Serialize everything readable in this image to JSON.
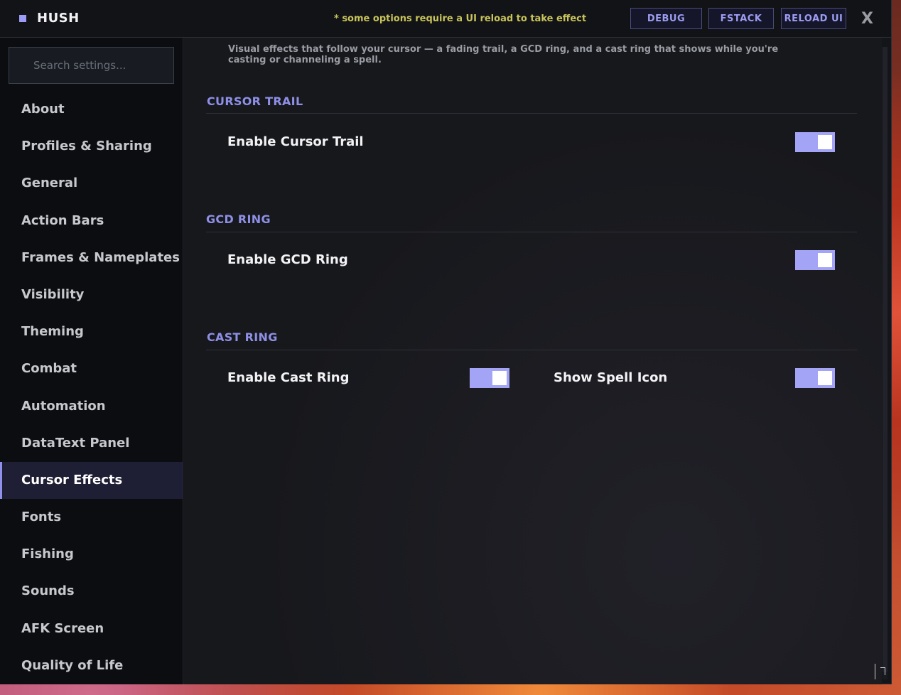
{
  "app": {
    "title": "HUSH",
    "reload_notice": "* some options require a UI reload to take effect",
    "accent": "#9b9cf6"
  },
  "toolbar": {
    "debug_label": "DEBUG",
    "fstack_label": "FSTACK",
    "reload_label": "RELOAD UI",
    "close_label": "X"
  },
  "sidebar": {
    "search_placeholder": "Search settings...",
    "items": [
      {
        "label": "About",
        "active": false
      },
      {
        "label": "Profiles & Sharing",
        "active": false
      },
      {
        "label": "General",
        "active": false
      },
      {
        "label": "Action Bars",
        "active": false
      },
      {
        "label": "Frames & Nameplates",
        "active": false
      },
      {
        "label": "Visibility",
        "active": false
      },
      {
        "label": "Theming",
        "active": false
      },
      {
        "label": "Combat",
        "active": false
      },
      {
        "label": "Automation",
        "active": false
      },
      {
        "label": "DataText Panel",
        "active": false
      },
      {
        "label": "Cursor Effects",
        "active": true
      },
      {
        "label": "Fonts",
        "active": false
      },
      {
        "label": "Fishing",
        "active": false
      },
      {
        "label": "Sounds",
        "active": false
      },
      {
        "label": "AFK Screen",
        "active": false
      },
      {
        "label": "Quality of Life",
        "active": false
      }
    ]
  },
  "main": {
    "description": "Visual effects that follow your cursor — a fading trail, a GCD ring, and a cast ring that shows while you're casting or channeling a spell.",
    "sections": {
      "cursor_trail": {
        "header": "CURSOR TRAIL",
        "options": [
          {
            "label": "Enable Cursor Trail",
            "enabled": true
          }
        ]
      },
      "gcd_ring": {
        "header": "GCD RING",
        "options": [
          {
            "label": "Enable GCD Ring",
            "enabled": true
          }
        ]
      },
      "cast_ring": {
        "header": "CAST RING",
        "options": [
          {
            "label": "Enable Cast Ring",
            "enabled": true
          },
          {
            "label": "Show Spell Icon",
            "enabled": true
          }
        ]
      }
    }
  }
}
